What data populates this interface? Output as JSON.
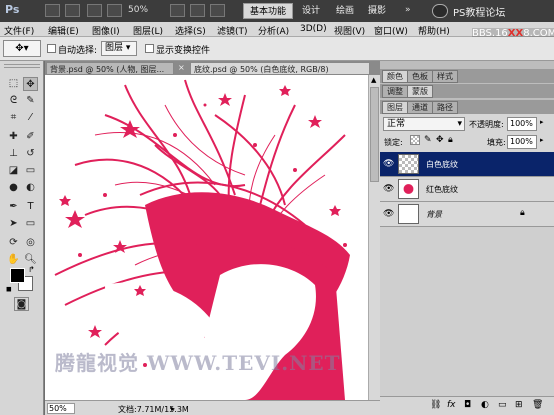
{
  "app": {
    "logo": "Ps",
    "zoom": "50%"
  },
  "workspaces": [
    {
      "label": "基本功能",
      "active": true
    },
    {
      "label": "设计",
      "active": false
    },
    {
      "label": "绘画",
      "active": false
    },
    {
      "label": "摄影",
      "active": false
    }
  ],
  "watermark": {
    "top_text": "PS教程论坛",
    "site_pre": "BBS.16",
    "site_x": "XX",
    "site_post": "8.COM",
    "canvas": "腾龍视觉 WWW.TEVI.NET"
  },
  "menus": [
    "文件(F)",
    "编辑(E)",
    "图像(I)",
    "图层(L)",
    "选择(S)",
    "滤镜(T)",
    "分析(A)",
    "3D(D)",
    "视图(V)",
    "窗口(W)",
    "帮助(H)"
  ],
  "options": {
    "auto_select_label": "自动选择:",
    "auto_select_value": "图层",
    "transform_label": "显示变换控件"
  },
  "tabs": [
    "背景.psd @ 50% (人物, 图层...",
    "底纹.psd @ 50% (白色底纹, RGB/8)"
  ],
  "status": {
    "zoom": "50%",
    "doc": "文档:7.71M/15.3M"
  },
  "panels": {
    "top_tabs": [
      "颜色",
      "色板",
      "样式"
    ],
    "mid_tabs": [
      "调整",
      "蒙版"
    ],
    "layer_tabs": [
      "图层",
      "通道",
      "路径"
    ],
    "blend_mode": "正常",
    "opacity_label": "不透明度:",
    "opacity_value": "100%",
    "lock_label": "锁定:",
    "fill_label": "填充:",
    "fill_value": "100%"
  },
  "layers": [
    {
      "name": "白色底纹",
      "selected": true
    },
    {
      "name": "红色底纹",
      "selected": false
    },
    {
      "name": "背景",
      "selected": false
    }
  ],
  "colors": {
    "accent": "#e0205a",
    "selection": "#0a246a"
  }
}
